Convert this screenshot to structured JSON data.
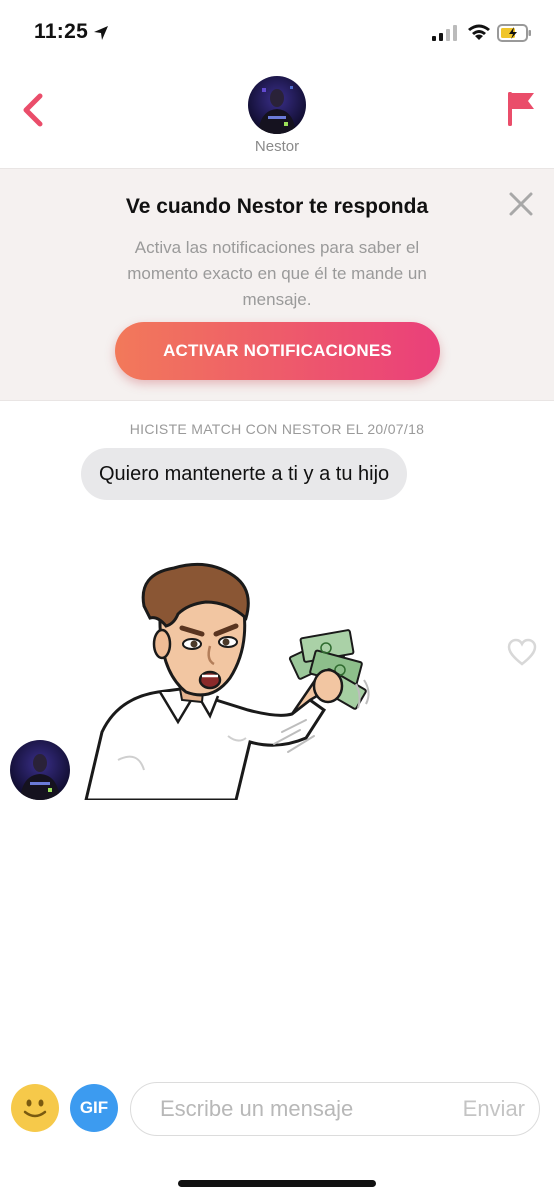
{
  "status_bar": {
    "time": "11:25"
  },
  "header": {
    "name": "Nestor"
  },
  "notification": {
    "title": "Ve cuando Nestor te responda",
    "text": "Activa las notificaciones para saber el momento exacto en que él te mande un mensaje.",
    "button_label": "ACTIVAR NOTIFICACIONES"
  },
  "chat": {
    "match_label": "HICISTE MATCH CON NESTOR EL 20/07/18",
    "message_text": "Quiero mantenerte a ti y a tu hijo"
  },
  "composer": {
    "gif_label": "GIF",
    "placeholder": "Escribe un mensaje",
    "send_label": "Enviar"
  },
  "colors": {
    "accent": "#ea3f6a",
    "button_gradient_start": "#f2795a",
    "button_gradient_end": "#ea3f7a",
    "gif_blue": "#3c9bf0",
    "emoji_yellow": "#f6c94a"
  }
}
